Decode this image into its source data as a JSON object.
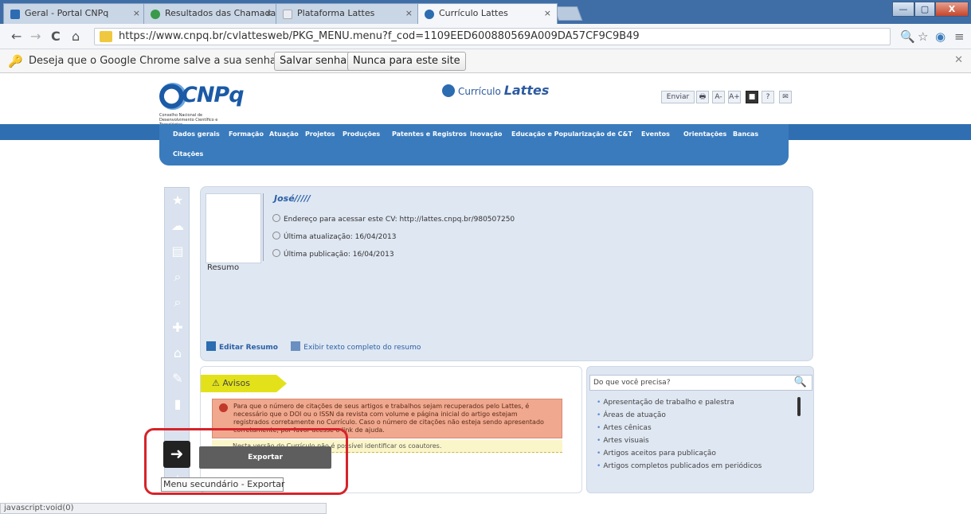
{
  "tabs": [
    {
      "title": "Geral - Portal CNPq",
      "icon_color": "#2d6cb2",
      "active": false
    },
    {
      "title": "Resultados das Chamadas",
      "icon_color": "#3a9a4a",
      "active": false
    },
    {
      "title": "Plataforma Lattes",
      "icon_color": "#cfd6e0",
      "active": false
    },
    {
      "title": "Currículo Lattes",
      "icon_color": "#2c6cb0",
      "active": true
    }
  ],
  "tab_close": "×",
  "window_controls": {
    "minimize": "—",
    "maximize": "▢",
    "close": "X"
  },
  "toolbar": {
    "back": "←",
    "forward": "→",
    "reload": "C",
    "home": "⌂",
    "url": "https://www.cnpq.br/cvlattesweb/PKG_MENU.menu?f_cod=1109EED600880569A009DA57CF9C9B49",
    "zoom_icon": "🔍",
    "star_icon": "☆",
    "ext_icon": "◉",
    "menu_icon": "≡"
  },
  "infobar": {
    "icon": "🔑",
    "message": "Deseja que o Google Chrome salve a sua senha?",
    "save_label": "Salvar senha",
    "never_label": "Nunca para este site",
    "close": "✕"
  },
  "header": {
    "logo_text": "CNPq",
    "logo_subtitle": "Conselho Nacional de Desenvolvimento Científico e Tecnológico",
    "lattes_prefix": "Currículo",
    "lattes_name": "Lattes",
    "tools": [
      "Enviar",
      "🖶",
      "A-",
      "A+",
      "■",
      "?",
      "✉"
    ]
  },
  "nav": {
    "items": [
      "Dados gerais",
      "Formação",
      "Atuação",
      "Projetos",
      "Produções",
      "Patentes e Registros",
      "Inovação",
      "Educação e Popularização de C&T",
      "Eventos",
      "Orientações",
      "Bancas"
    ],
    "second_row": "Citações"
  },
  "sidebar": {
    "icons": [
      "★",
      "☁",
      "▤",
      "⌕",
      "⌕",
      "✚",
      "⌂",
      "✎",
      "▮",
      "",
      "➜",
      "⇣"
    ]
  },
  "profile": {
    "name": "José/////",
    "address_label": "Endereço para acessar este CV: http://lattes.cnpq.br/980507250",
    "last_update": "Última atualização: 16/04/2013",
    "last_publication": "Última publicação: 16/04/2013",
    "resumo": "Resumo",
    "edit_resumo": "Editar Resumo",
    "exibir_resumo": "Exibir texto completo do resumo"
  },
  "avisos": {
    "title": "Avisos",
    "warning_text": "Para que o número de citações de seus artigos e trabalhos sejam recuperados pelo Lattes, é necessário que o DOI ou o ISSN da revista com volume e página inicial do artigo estejam registrados corretamente no Currículo. Caso o número de citações não esteja sendo apresentado corretamente, por favor acesse o link de ajuda.",
    "info_text": "Nesta versão do Currículo não é possível identificar os coautores.",
    "export_label": "Exportar"
  },
  "search": {
    "placeholder": "Do que você precisa?",
    "icon": "🔍",
    "items": [
      "Apresentação de trabalho e palestra",
      "Áreas de atuação",
      "Artes cênicas",
      "Artes visuais",
      "Artigos aceitos para publicação",
      "Artigos completos publicados em periódicos"
    ]
  },
  "tooltip": "Menu secundário - Exportar",
  "statusbar": "javascript:void(0)",
  "colors": {
    "accent": "#2f6fb1",
    "highlight": "#d6232a",
    "avisos": "#e3e21a"
  }
}
